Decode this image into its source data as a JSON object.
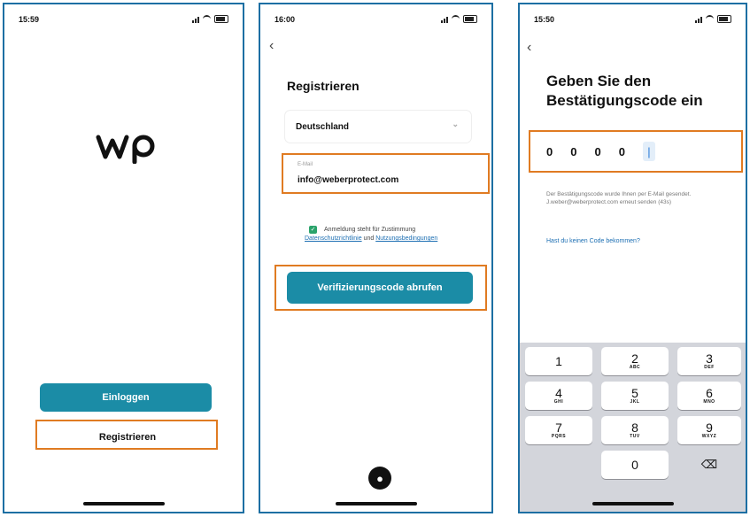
{
  "screens": [
    {
      "time": "15:59",
      "login_button": "Einloggen",
      "register_button": "Registrieren",
      "accent": "#1b8ca6",
      "highlight": "#e07b22"
    },
    {
      "time": "16:00",
      "title": "Registrieren",
      "country": "Deutschland",
      "email_label": "E-Mail",
      "email_value": "info@weberprotect.com",
      "terms_prefix": "Anmeldung steht für Zustimmung",
      "privacy_link": "Datenschutzrichtlinie",
      "terms_and": "und",
      "terms_link": "Nutzungsbedingungen",
      "verify_button": "Verifizierungscode abrufen"
    },
    {
      "time": "15:50",
      "title": "Geben Sie den Bestätigungscode ein",
      "code_digits": [
        "0",
        "0",
        "0",
        "0"
      ],
      "info": "Der Bestätigungscode wurde Ihnen per E-Mail gesendet. J.weber@weberprotect.com erneut senden (43s)",
      "no_code_link": "Hast du keinen Code bekommen?",
      "keys": [
        {
          "digit": "1",
          "letters": ""
        },
        {
          "digit": "2",
          "letters": "ABC"
        },
        {
          "digit": "3",
          "letters": "DEF"
        },
        {
          "digit": "4",
          "letters": "GHI"
        },
        {
          "digit": "5",
          "letters": "JKL"
        },
        {
          "digit": "6",
          "letters": "MNO"
        },
        {
          "digit": "7",
          "letters": "PQRS"
        },
        {
          "digit": "8",
          "letters": "TUV"
        },
        {
          "digit": "9",
          "letters": "WXYZ"
        },
        {
          "digit": "0",
          "letters": ""
        }
      ]
    }
  ]
}
